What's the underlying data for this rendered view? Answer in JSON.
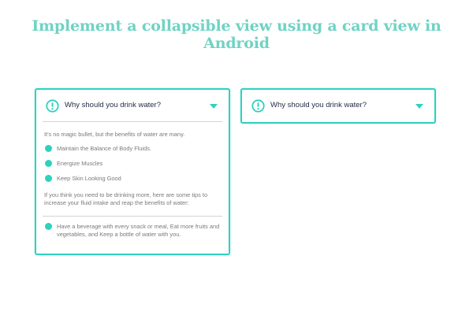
{
  "page": {
    "title": "Implement a collapsible view using a card view in Android"
  },
  "colors": {
    "accent": "#2fd1be",
    "title": "#6fd3c4",
    "heading_text": "#1f2a44",
    "body_text": "#7a7a7a"
  },
  "cards": [
    {
      "state": "expanded",
      "icon": "info-icon",
      "title": "Why should you drink water?",
      "toggle_icon": "chevron-down-icon",
      "intro": "It's no magic bullet, but the benefits of water are many.",
      "benefits": [
        "Maintain the Balance of Body Fluids.",
        "Energize Muscles",
        "Keep Skin Looking Good"
      ],
      "tips_intro": "If you think you need to be drinking more, here are some tips to increase your fluid intake and reap the benefits of water:",
      "tips": [
        "Have a beverage with every snack or meal, Eat more fruits and vegetables, and Keep a bottle of water with you."
      ]
    },
    {
      "state": "collapsed",
      "icon": "info-icon",
      "title": "Why should you drink water?",
      "toggle_icon": "chevron-down-icon"
    }
  ]
}
